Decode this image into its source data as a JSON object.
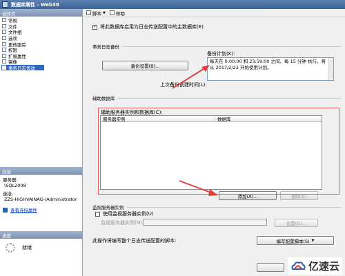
{
  "window": {
    "title": "数据库属性 - Web38"
  },
  "left": {
    "pages_header": "选择页",
    "pages": [
      "常规",
      "文件",
      "文件组",
      "选项",
      "更改跟踪",
      "权限",
      "扩展属性",
      "镜像",
      "事务日志传送"
    ],
    "selected_index": 8,
    "connection_header": "连接",
    "server_label": "服务器:",
    "server_value": "\\SQL2008",
    "connection_label": "连接:",
    "connection_value": "ZZS-HIGHVAINAG-\\Administrator",
    "view_conn_link": "查看连接属性",
    "progress_header": "进度",
    "progress_status": "就绪"
  },
  "toolbar": {
    "script_label": "脚本",
    "help_label": "帮助"
  },
  "main": {
    "enable_checkbox_label": "将此数据库启用为日志传送配置中的主数据库(E)",
    "enable_checked": true,
    "backup_section_title": "事务日志备份",
    "backup_settings_btn": "备份设置(B)...",
    "backup_schedule_label": "备份计划(K):",
    "backup_schedule_text": "每天在 0:00:00 和 23:59:00 之间、每 15 分钟 执行。将从 2017/2/23 开始使用计划。",
    "last_backup_label": "上次备份创建时间(L):",
    "secondary_section_title": "辅助数据库",
    "secondary_list_label": "辅助服务器实例和数据库(C):",
    "grid_col_server": "服务器实例",
    "grid_col_database": "数据库",
    "add_btn": "添加(A)...",
    "remove_btn": "删除(E)",
    "monitor_section_title": "监视服务器实例",
    "use_monitor_label": "使用监视服务器实例(U)",
    "monitor_instance_label": "监视服务器实例(M):",
    "settings_btn": "设置(G)...",
    "script_config_label": "此操作将编写整个日志传送配置的脚本:",
    "script_config_btn": "编写配置脚本(S)"
  },
  "watermark": {
    "text": "亿速云"
  }
}
